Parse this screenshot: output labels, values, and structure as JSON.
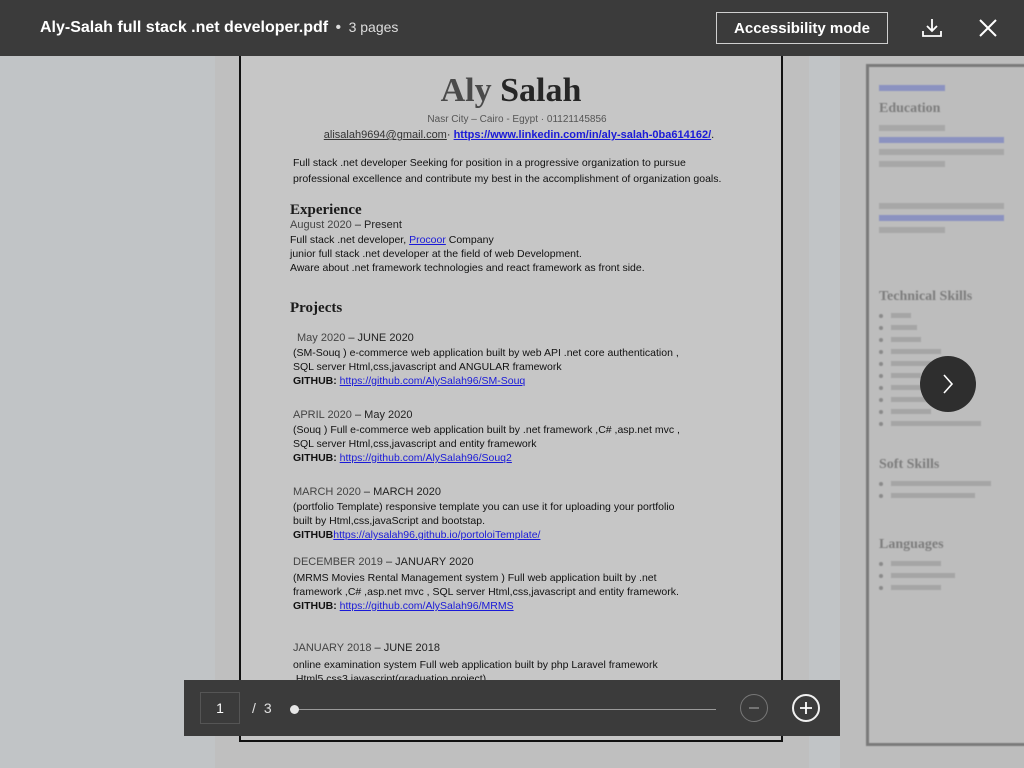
{
  "header": {
    "file_name": "Aly-Salah full stack .net developer.pdf",
    "separator": "•",
    "page_count": "3 pages",
    "accessibility_button": "Accessibility mode",
    "download_icon": "download-icon",
    "close_icon": "close-icon"
  },
  "resume": {
    "first_name": "Aly",
    "last_name": "Salah",
    "address": "Nasr City – Cairo - Egypt · 01121145856",
    "email": "alisalah9694@gmail.com",
    "contact_sep": "·",
    "linkedin": "https://www.linkedin.com/in/aly-salah-0ba614162/",
    "linkedin_suffix": ".",
    "summary_1": "Full stack .net developer Seeking for position in a progressive organization to pursue",
    "summary_2": "professional excellence and contribute my best in the accomplishment of organization goals.",
    "experience_heading": "Experience",
    "exp_date_start": "August 2020",
    "exp_date_end": "– Present",
    "exp_line1_prefix": "Full stack .net developer, ",
    "exp_company": "Procoor",
    "exp_line1_suffix": " Company",
    "exp_line2": "junior full stack .net developer at the field of web Development.",
    "exp_line3": "Aware about .net framework technologies and react framework as front side.",
    "projects_heading": "Projects",
    "projects": [
      {
        "date_start": "May 2020",
        "date_end": "– JUNE 2020",
        "line1": "(SM-Souq ) e-commerce web application built by web API .net core authentication ,",
        "line2": "SQL server Html,css,javascript and ANGULAR framework",
        "github_label": "GITHUB:",
        "github_url": "https://github.com/AlySalah96/SM-Souq"
      },
      {
        "date_start": "APRIL 2020",
        "date_end": "– May 2020",
        "line1": "(Souq ) Full  e-commerce web application built by .net framework ,C# ,asp.net mvc ,",
        "line2": "SQL server Html,css,javascript and entity framework",
        "github_label": "GITHUB:",
        "github_url": "https://github.com/AlySalah96/Souq2"
      },
      {
        "date_start": "MARCH 2020",
        "date_end": "– MARCH 2020",
        "line1": "(portfolio Template) responsive template you can use it for uploading your portfolio",
        "line2": "built by Html,css,javaScript and bootstap.",
        "github_label": "GITHUB",
        "github_url": "https://alysalah96.github.io/portoloiTemplate/"
      },
      {
        "date_start": "DECEMBER 2019",
        "date_end": "– JANUARY 2020",
        "line1": "(MRMS Movies Rental Management system ) Full web application built by .net",
        "line2": "framework ,C# ,asp.net mvc , SQL server Html,css,javascript and entity framework.",
        "github_label": "GITHUB:",
        "github_url": "https://github.com/AlySalah96/MRMS"
      },
      {
        "date_start": "JANUARY 2018",
        "date_end": "– JUNE 2018",
        "line1": "online examination system Full web application built by php Laravel framework",
        "line2": ".Html5.css3.javascript(graduation project)"
      }
    ]
  },
  "next_page_preview": {
    "education": "Education",
    "technical_skills": "Technical Skills",
    "soft_skills": "Soft Skills",
    "languages": "Languages"
  },
  "navigation": {
    "next_icon": "chevron-right-icon"
  },
  "footer": {
    "current_page": "1",
    "slash": "/",
    "total_pages": "3",
    "progress_fraction": 0,
    "zoom_out_icon": "zoom-out-icon",
    "zoom_in_icon": "zoom-in-icon"
  }
}
